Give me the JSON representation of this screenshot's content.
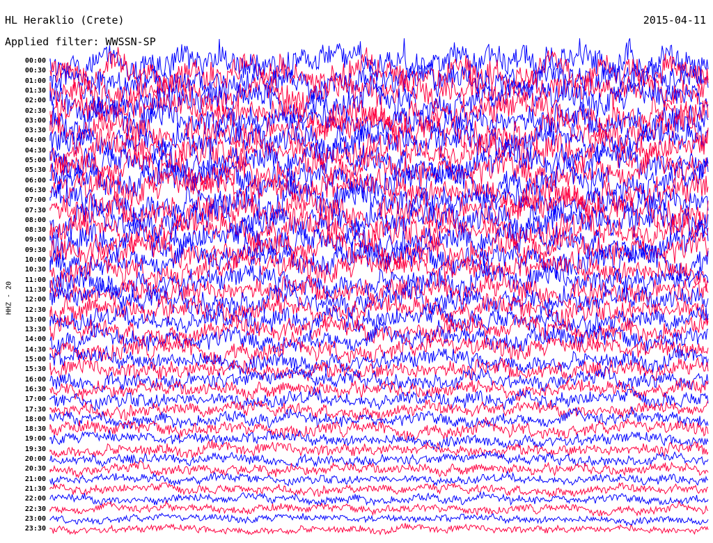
{
  "header": {
    "station": "HL Heraklio (Crete)",
    "date": "2015-04-11",
    "filter": "Applied filter: WWSSN-SP"
  },
  "channel_label": "HHZ - 20",
  "chart_data": {
    "type": "line",
    "title": "HL Heraklio (Crete)",
    "subtitle": "Applied filter: WWSSN-SP",
    "ylabel": "HHZ - 20",
    "row_labels": [
      "00:00",
      "00:30",
      "01:00",
      "01:30",
      "02:00",
      "02:30",
      "03:00",
      "03:30",
      "04:00",
      "04:30",
      "05:00",
      "05:30",
      "06:00",
      "06:30",
      "07:00",
      "07:30",
      "08:00",
      "08:30",
      "09:00",
      "09:30",
      "10:00",
      "10:30",
      "11:00",
      "11:30",
      "12:00",
      "12:30",
      "13:00",
      "13:30",
      "14:00",
      "14:30",
      "15:00",
      "15:30",
      "16:00",
      "16:30",
      "17:00",
      "17:30",
      "18:00",
      "18:30",
      "19:00",
      "19:30",
      "20:00",
      "20:30",
      "21:00",
      "21:30",
      "22:00",
      "22:30",
      "23:00",
      "23:30"
    ],
    "trace_colors": [
      "#0000ff",
      "#ff0040"
    ],
    "relative_amplitude_by_hour": [
      1.0,
      1.0,
      1.0,
      1.0,
      1.0,
      1.0,
      1.0,
      1.0,
      1.0,
      1.0,
      1.0,
      1.0,
      1.0,
      1.0,
      1.0,
      1.0,
      1.0,
      1.0,
      0.95,
      0.95,
      0.9,
      0.85,
      0.8,
      0.8,
      0.8,
      0.75,
      0.7,
      0.7,
      0.7,
      0.65,
      0.6,
      0.6,
      0.55,
      0.5,
      0.5,
      0.45,
      0.45,
      0.45,
      0.4,
      0.4,
      0.35,
      0.35,
      0.3,
      0.3,
      0.3,
      0.28,
      0.25,
      0.25
    ],
    "grid": false,
    "legend": "none"
  }
}
